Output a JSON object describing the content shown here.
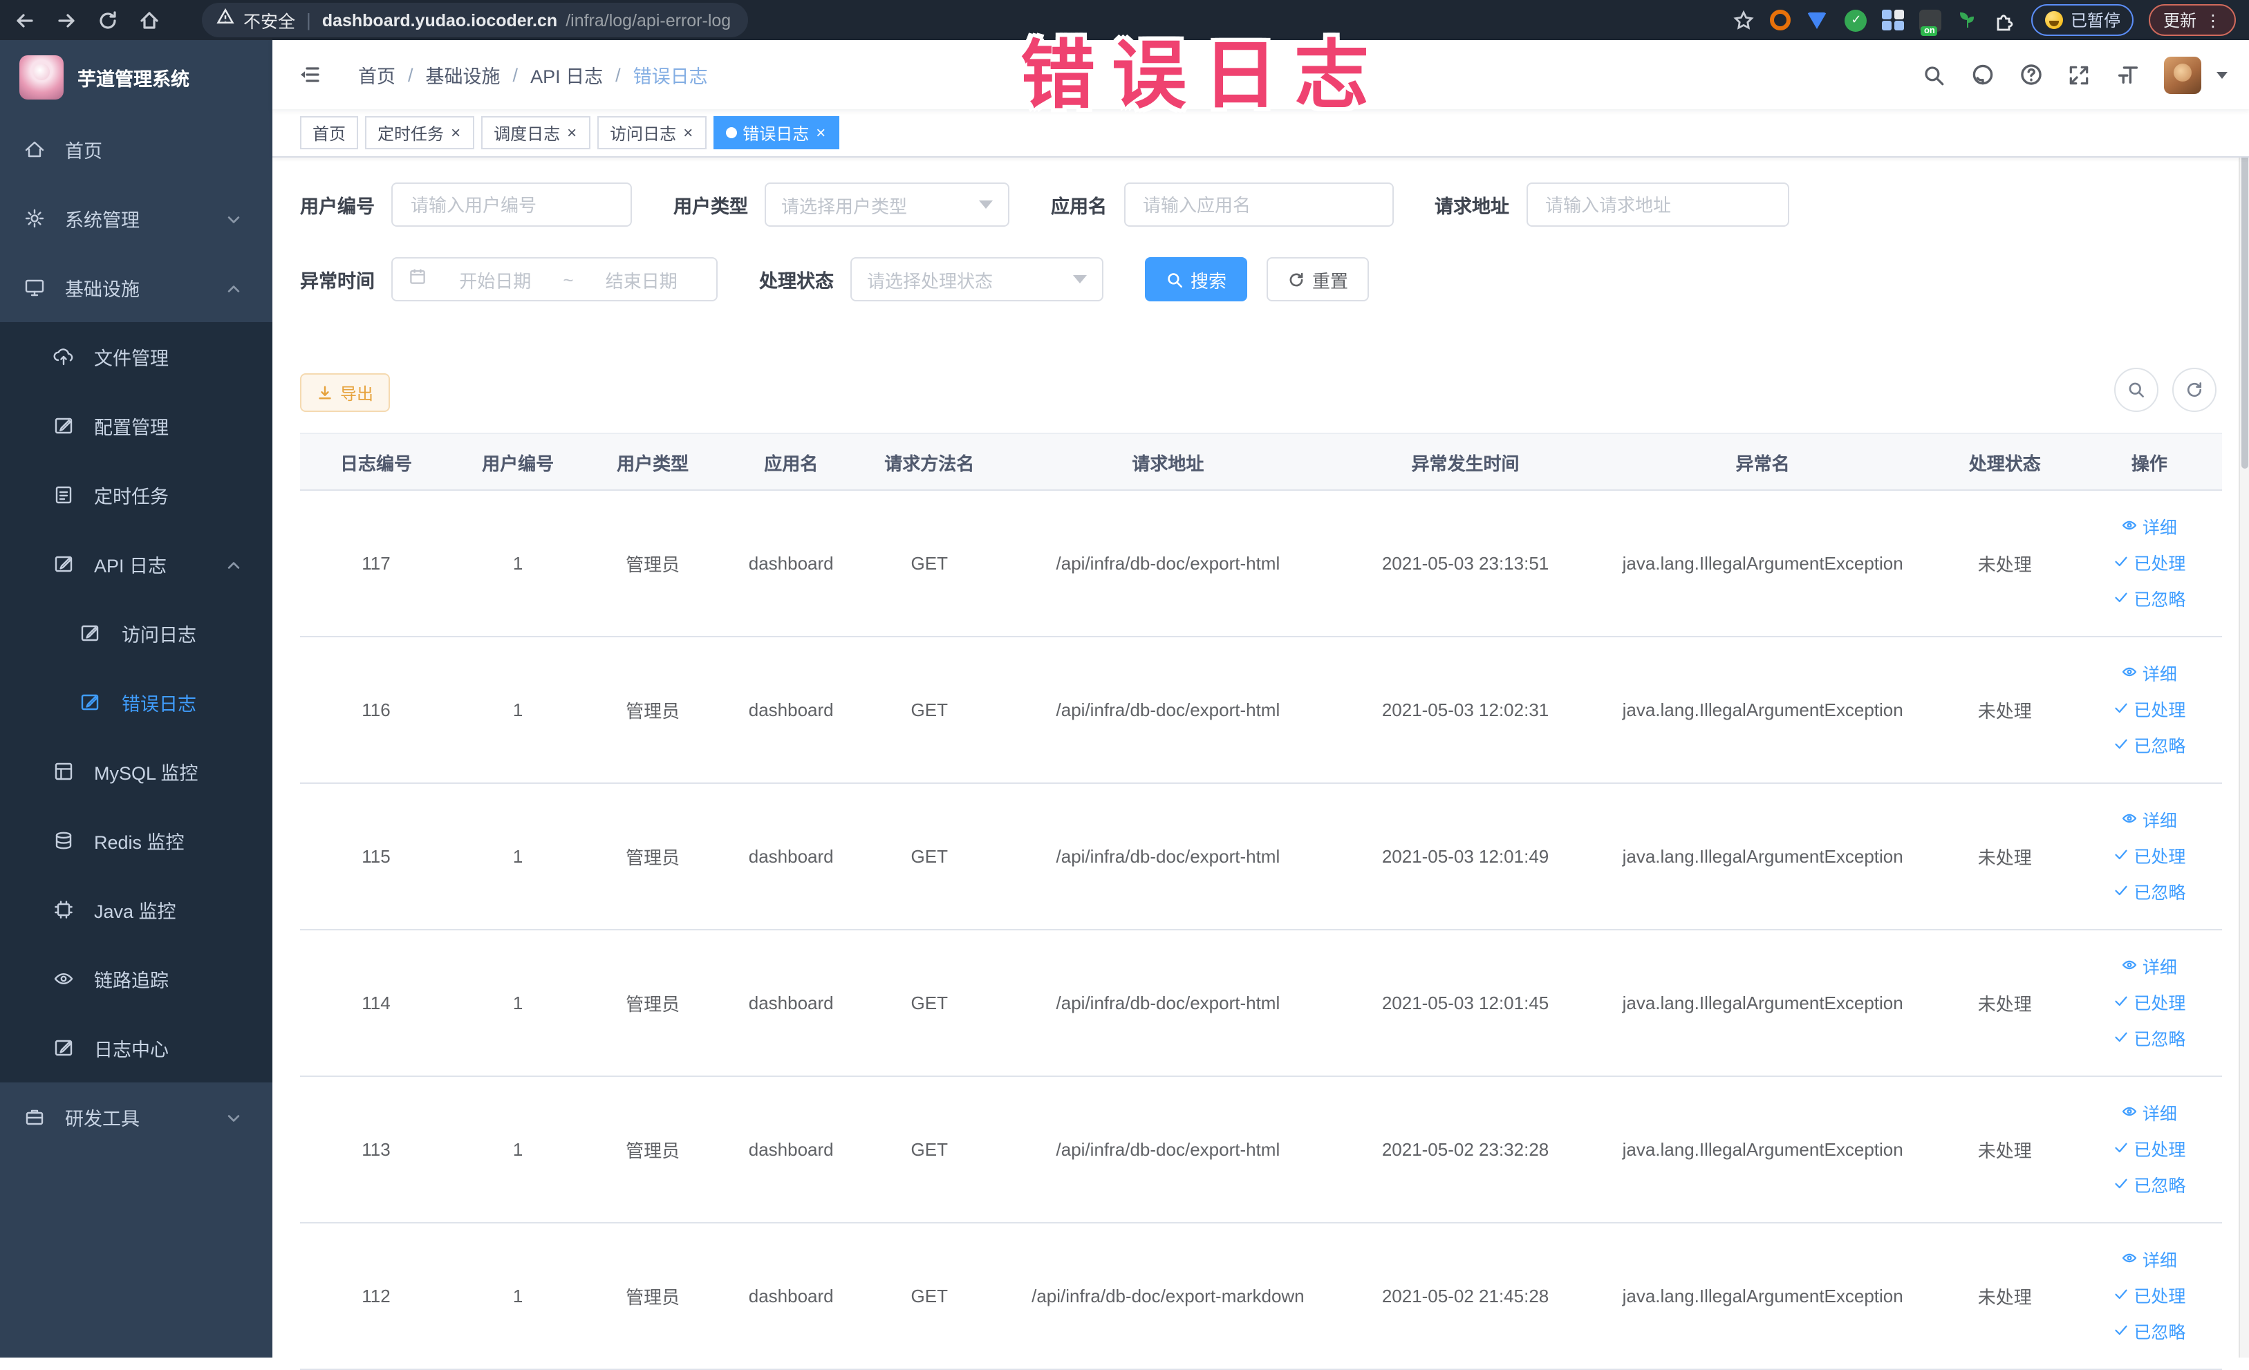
{
  "annotation": {
    "text": "错误日志",
    "color": "#ef4270"
  },
  "browser": {
    "security_label": "不安全",
    "url_domain": "dashboard.yudao.iocoder.cn",
    "url_path": "/infra/log/api-error-log",
    "paused_label": "已暂停",
    "update_label": "更新"
  },
  "sidebar": {
    "logo_title": "芋道管理系统",
    "items": [
      {
        "name": "home",
        "label": "首页",
        "icon": "home-icon",
        "level": 1
      },
      {
        "name": "system-management",
        "label": "系统管理",
        "icon": "gear-icon",
        "level": 1,
        "chevron": "down"
      },
      {
        "name": "infrastructure",
        "label": "基础设施",
        "icon": "monitor-icon",
        "level": 1,
        "chevron": "up"
      },
      {
        "name": "file-management",
        "label": "文件管理",
        "icon": "upload-icon",
        "level": 2
      },
      {
        "name": "config-management",
        "label": "配置管理",
        "icon": "edit-icon",
        "level": 2
      },
      {
        "name": "scheduled-task",
        "label": "定时任务",
        "icon": "task-icon",
        "level": 2
      },
      {
        "name": "api-log",
        "label": "API 日志",
        "icon": "compose-icon",
        "level": 2,
        "chevron": "up"
      },
      {
        "name": "access-log",
        "label": "访问日志",
        "icon": "compose-icon",
        "level": 3
      },
      {
        "name": "error-log",
        "label": "错误日志",
        "icon": "compose-icon",
        "level": 3,
        "active": true
      },
      {
        "name": "mysql-monitor",
        "label": "MySQL 监控",
        "icon": "mysql-icon",
        "level": 2
      },
      {
        "name": "redis-monitor",
        "label": "Redis 监控",
        "icon": "redis-icon",
        "level": 2
      },
      {
        "name": "java-monitor",
        "label": "Java 监控",
        "icon": "java-icon",
        "level": 2
      },
      {
        "name": "trace",
        "label": "链路追踪",
        "icon": "eye-icon",
        "level": 2
      },
      {
        "name": "log-center",
        "label": "日志中心",
        "icon": "compose-icon",
        "level": 2
      },
      {
        "name": "dev-tools",
        "label": "研发工具",
        "icon": "briefcase-icon",
        "level": 1,
        "chevron": "down"
      }
    ]
  },
  "header": {
    "breadcrumb": [
      "首页",
      "基础设施",
      "API 日志",
      "错误日志"
    ]
  },
  "tabs": [
    {
      "name": "tab-home",
      "label": "首页",
      "closable": false,
      "active": false
    },
    {
      "name": "tab-scheduled-task",
      "label": "定时任务",
      "closable": true,
      "active": false
    },
    {
      "name": "tab-schedule-log",
      "label": "调度日志",
      "closable": true,
      "active": false
    },
    {
      "name": "tab-access-log",
      "label": "访问日志",
      "closable": true,
      "active": false
    },
    {
      "name": "tab-error-log",
      "label": "错误日志",
      "closable": true,
      "active": true
    }
  ],
  "filters": {
    "user_id": {
      "label": "用户编号",
      "placeholder": "请输入用户编号"
    },
    "user_type": {
      "label": "用户类型",
      "placeholder": "请选择用户类型"
    },
    "app_name": {
      "label": "应用名",
      "placeholder": "请输入应用名"
    },
    "request_url": {
      "label": "请求地址",
      "placeholder": "请输入请求地址"
    },
    "exception_time": {
      "label": "异常时间",
      "start_placeholder": "开始日期",
      "separator": "~",
      "end_placeholder": "结束日期"
    },
    "process_status": {
      "label": "处理状态",
      "placeholder": "请选择处理状态"
    },
    "search_label": "搜索",
    "reset_label": "重置"
  },
  "toolbar": {
    "export_label": "导出"
  },
  "table": {
    "columns": [
      "日志编号",
      "用户编号",
      "用户类型",
      "应用名",
      "请求方法名",
      "请求地址",
      "异常发生时间",
      "异常名",
      "处理状态",
      "操作"
    ],
    "actions": [
      "详细",
      "已处理",
      "已忽略"
    ],
    "rows": [
      {
        "id": "117",
        "user_id": "1",
        "user_type": "管理员",
        "app": "dashboard",
        "method": "GET",
        "url": "/api/infra/db-doc/export-html",
        "time": "2021-05-03 23:13:51",
        "exception": "java.lang.IllegalArgumentException",
        "status": "未处理"
      },
      {
        "id": "116",
        "user_id": "1",
        "user_type": "管理员",
        "app": "dashboard",
        "method": "GET",
        "url": "/api/infra/db-doc/export-html",
        "time": "2021-05-03 12:02:31",
        "exception": "java.lang.IllegalArgumentException",
        "status": "未处理"
      },
      {
        "id": "115",
        "user_id": "1",
        "user_type": "管理员",
        "app": "dashboard",
        "method": "GET",
        "url": "/api/infra/db-doc/export-html",
        "time": "2021-05-03 12:01:49",
        "exception": "java.lang.IllegalArgumentException",
        "status": "未处理"
      },
      {
        "id": "114",
        "user_id": "1",
        "user_type": "管理员",
        "app": "dashboard",
        "method": "GET",
        "url": "/api/infra/db-doc/export-html",
        "time": "2021-05-03 12:01:45",
        "exception": "java.lang.IllegalArgumentException",
        "status": "未处理"
      },
      {
        "id": "113",
        "user_id": "1",
        "user_type": "管理员",
        "app": "dashboard",
        "method": "GET",
        "url": "/api/infra/db-doc/export-html",
        "time": "2021-05-02 23:32:28",
        "exception": "java.lang.IllegalArgumentException",
        "status": "未处理"
      },
      {
        "id": "112",
        "user_id": "1",
        "user_type": "管理员",
        "app": "dashboard",
        "method": "GET",
        "url": "/api/infra/db-doc/export-markdown",
        "time": "2021-05-02 21:45:28",
        "exception": "java.lang.IllegalArgumentException",
        "status": "未处理"
      }
    ]
  },
  "colors": {
    "primary": "#409eff",
    "warning": "#e6a23c",
    "sidebar_bg": "#304156",
    "submenu_bg": "#1f2d3d"
  }
}
